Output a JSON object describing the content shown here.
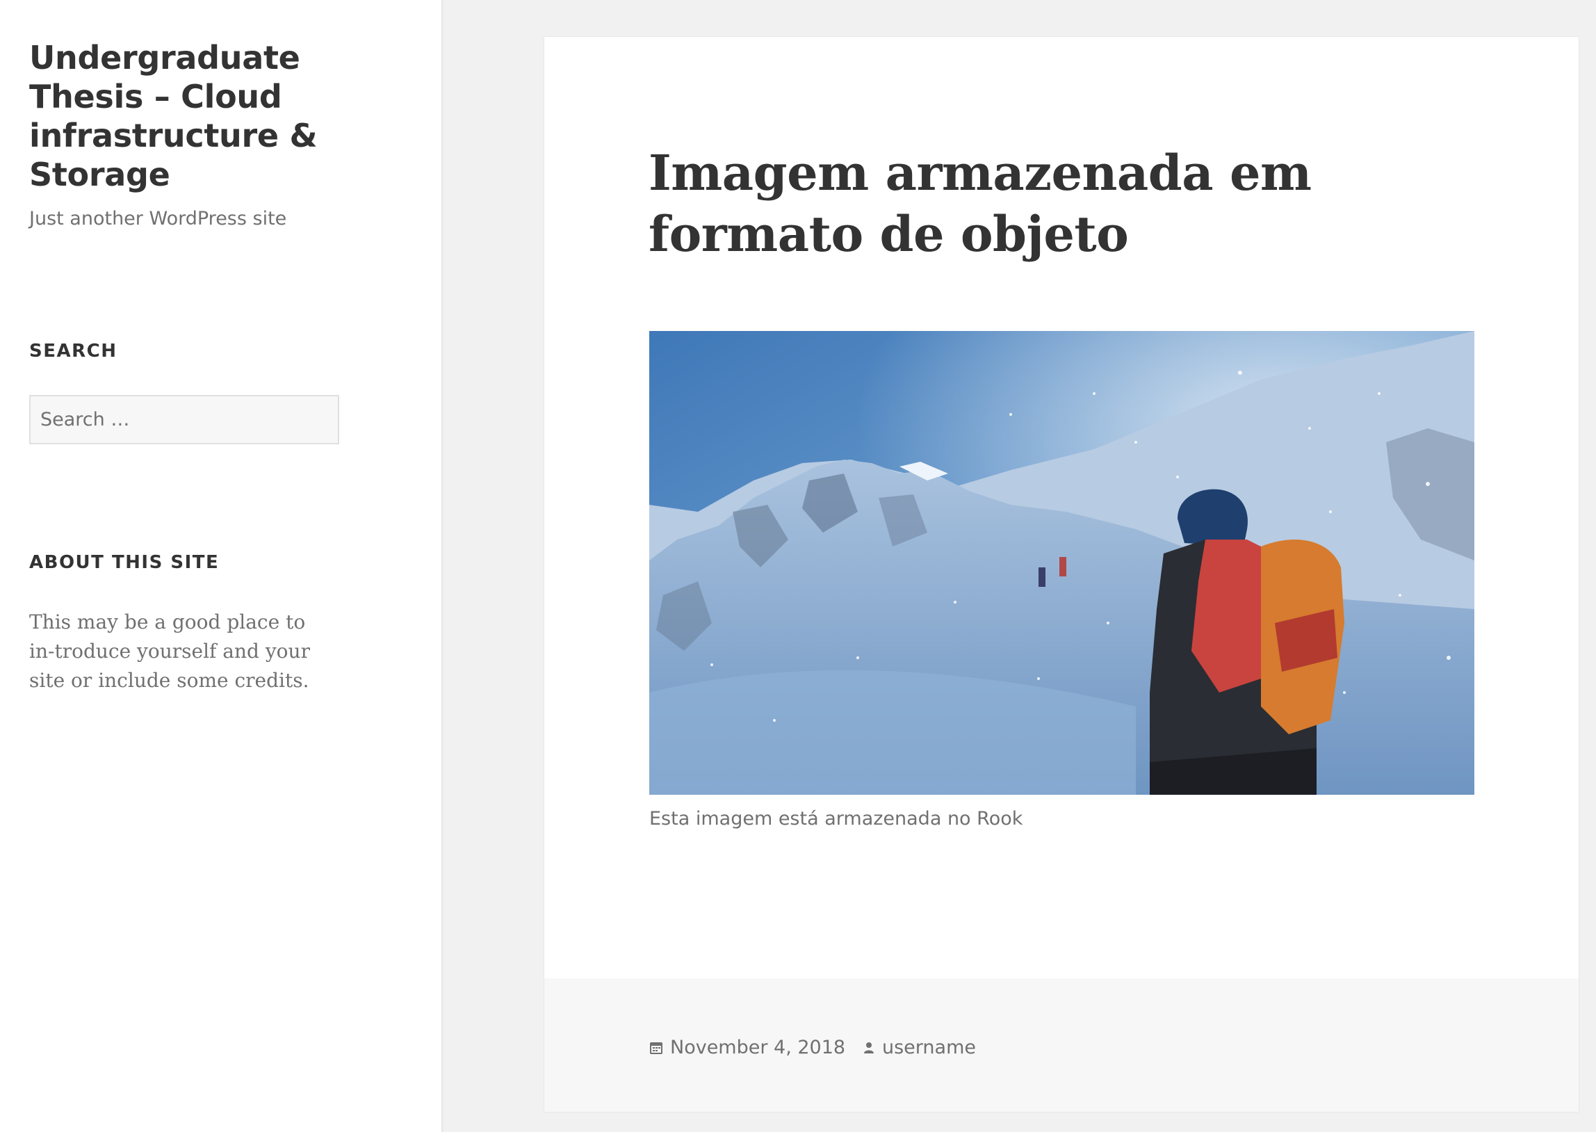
{
  "site": {
    "title": "Undergraduate Thesis – Cloud infrastructure & Storage",
    "description": "Just another WordPress site"
  },
  "sidebar": {
    "search": {
      "heading": "SEARCH",
      "placeholder": "Search …"
    },
    "about": {
      "heading": "ABOUT THIS SITE",
      "text": "This may be a good place to in-troduce yourself and your site or include some credits."
    }
  },
  "post": {
    "title": "Imagem armazenada em formato de objeto",
    "image_caption": "Esta imagem está armazenada no Rook",
    "date": "November 4, 2018",
    "author": "username",
    "date_icon": "calendar-icon",
    "author_icon": "user-icon"
  },
  "colors": {
    "background": "#f1f1f1",
    "text": "#333333",
    "meta": "#707070",
    "footer": "#f7f7f7"
  }
}
